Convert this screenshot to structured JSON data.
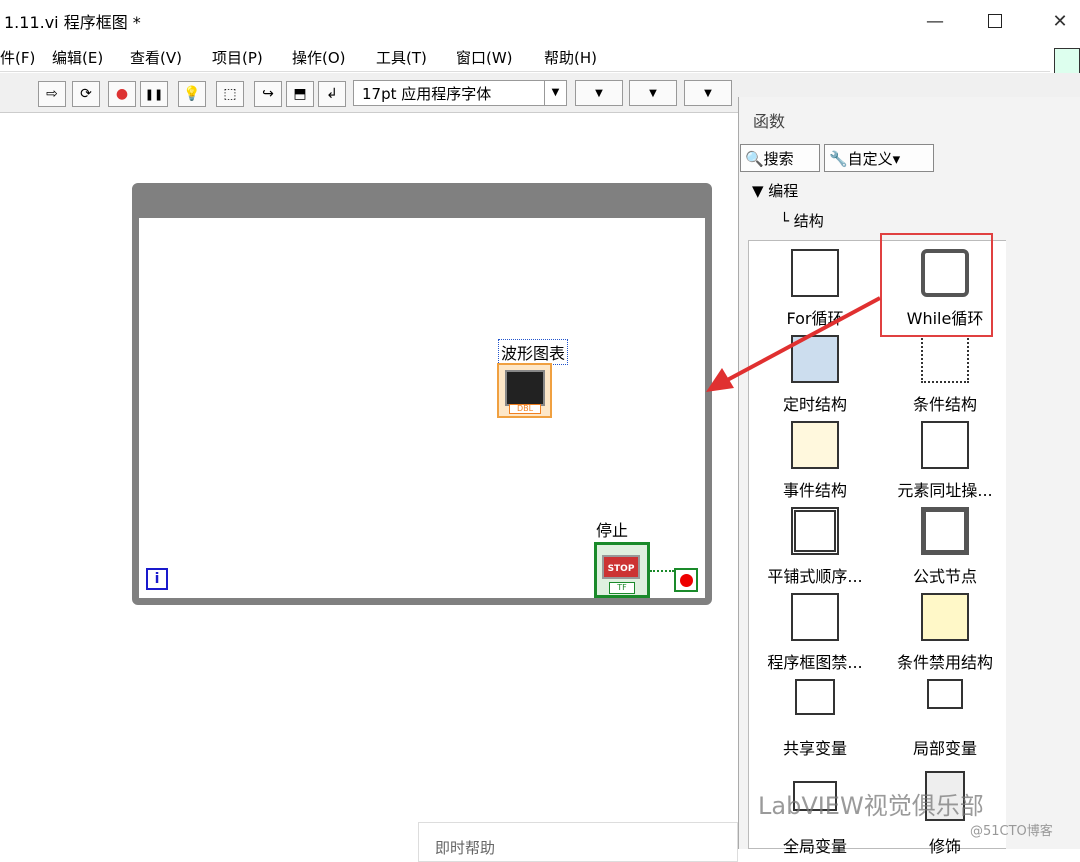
{
  "window": {
    "title": "1.11.vi 程序框图 *",
    "min": "—",
    "close": "✕"
  },
  "menu": [
    "件(F)",
    "编辑(E)",
    "查看(V)",
    "项目(P)",
    "操作(O)",
    "工具(T)",
    "窗口(W)",
    "帮助(H)"
  ],
  "toolbar": {
    "icons": [
      "⇨",
      "⟳",
      "●",
      "❚❚",
      "💡",
      "⬚",
      "↪",
      "⬒",
      "↲"
    ],
    "font": "17pt 应用程序字体",
    "dropdown": "▼"
  },
  "diagram": {
    "iteration": "i",
    "waveform_label": "波形图表",
    "waveform_type": "DBL",
    "stop_label": "停止",
    "stop_button": "STOP",
    "stop_type": "TF"
  },
  "context_help": "即时帮助",
  "palette": {
    "title": "函数",
    "search": "🔍搜索",
    "customize": "🔧自定义▾",
    "category": "▼ 编程",
    "subcategory": "└ 结构",
    "items": [
      {
        "label": "For循环",
        "icon": "for-loop-icon"
      },
      {
        "label": "While循环",
        "icon": "while-loop-icon"
      },
      {
        "label": "定时结构",
        "icon": "timed-structure-icon"
      },
      {
        "label": "条件结构",
        "icon": "case-structure-icon"
      },
      {
        "label": "事件结构",
        "icon": "event-structure-icon"
      },
      {
        "label": "元素同址操...",
        "icon": "in-place-element-icon"
      },
      {
        "label": "平铺式顺序...",
        "icon": "flat-sequence-icon"
      },
      {
        "label": "公式节点",
        "icon": "formula-node-icon"
      },
      {
        "label": "程序框图禁...",
        "icon": "diagram-disable-icon"
      },
      {
        "label": "条件禁用结构",
        "icon": "conditional-disable-icon"
      },
      {
        "label": "共享变量",
        "icon": "shared-variable-icon"
      },
      {
        "label": "局部变量",
        "icon": "local-variable-icon"
      },
      {
        "label": "全局变量",
        "icon": "global-variable-icon"
      },
      {
        "label": "修饰",
        "icon": "decorations-icon"
      }
    ]
  },
  "watermark": "LabVIEW视觉俱乐部",
  "watermark_source": "@51CTO博客"
}
